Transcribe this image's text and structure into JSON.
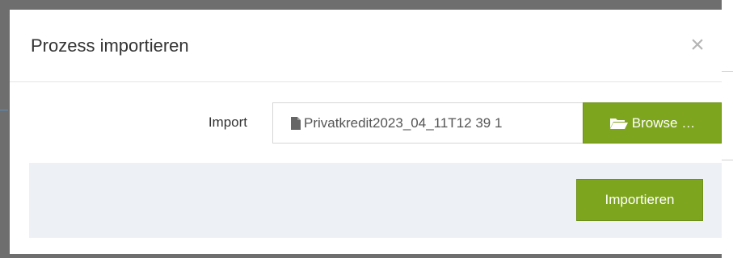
{
  "dialog": {
    "title": "Prozess importieren",
    "close_label": "×"
  },
  "import": {
    "label": "Import",
    "file_name": "Privatkredit2023_04_11T12 39 1",
    "browse_label": "Browse …"
  },
  "footer": {
    "submit_label": "Importieren"
  },
  "colors": {
    "accent": "#7ea51e",
    "footer_bg": "#edf1f6",
    "overlay": "#6e6e6e"
  }
}
